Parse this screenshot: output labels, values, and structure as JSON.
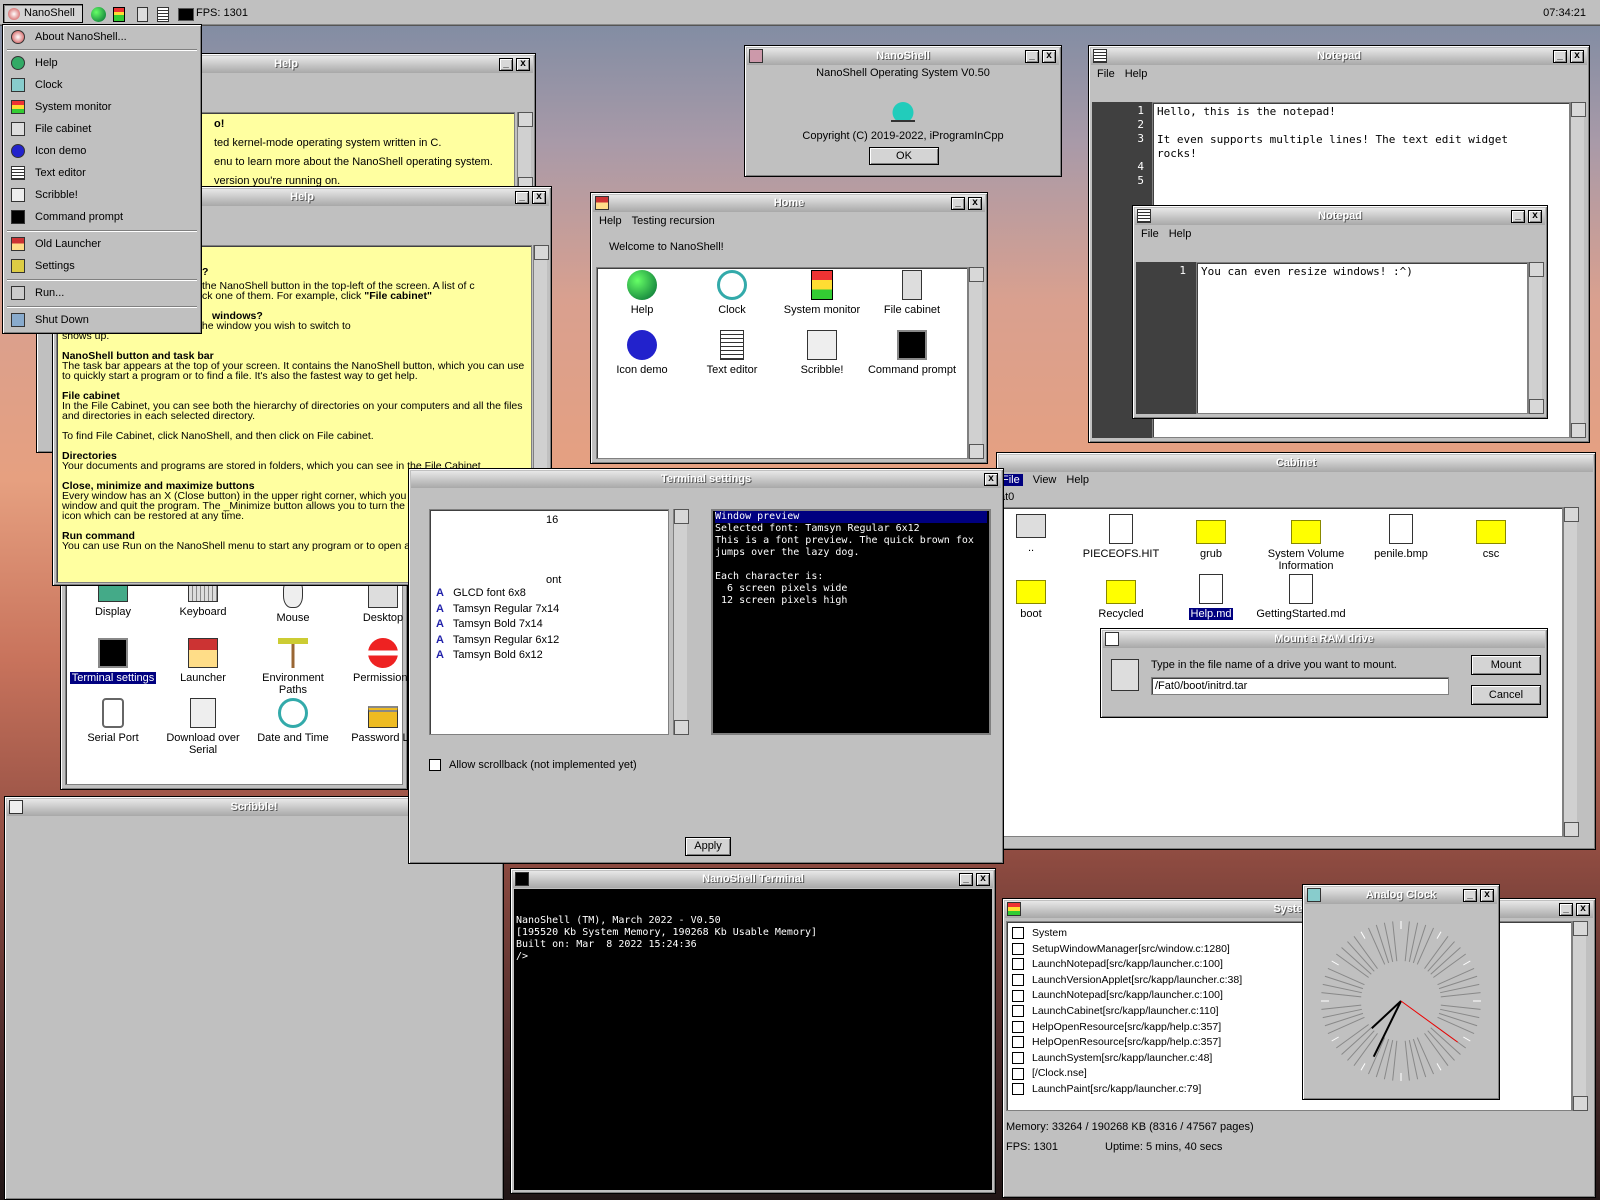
{
  "taskbar": {
    "start": "NanoShell",
    "fps": "FPS: 1301",
    "clock": "07:34:21"
  },
  "start_menu": [
    "About NanoShell...",
    "Help",
    "Clock",
    "System monitor",
    "File cabinet",
    "Icon demo",
    "Text editor",
    "Scribble!",
    "Command prompt",
    "Old Launcher",
    "Settings",
    "Run...",
    "Shut Down"
  ],
  "help1": {
    "title": "Help",
    "lines": [
      "o!",
      "ted kernel-mode operating system written in C.",
      "enu to learn more about the NanoShell operating system.",
      "version you're running on."
    ]
  },
  "help2": {
    "title": "Help",
    "q1": "?",
    "p1a": "the NanoShell button in the top-left of the screen.  A list of c",
    "p1b": "ck one of them.  For example, click ",
    "p1c": "\"File cabinet\"",
    "q2": "windows?",
    "p2a": "hold ALT and press TAB until the window you wish to switch to",
    "p2b": "shows up.",
    "h1": "NanoShell button and task bar",
    "t1": "The task bar appears at the top of your screen.  It contains the NanoShell button, which you can use to quickly start a program or to find a file.  It's also the fastest way to get help.",
    "h2": "File cabinet",
    "t2": "In the File Cabinet, you can see both the hierarchy of directories on your computers and all the files and directories in each selected directory.",
    "t3": "To find File Cabinet, click NanoShell, and then click on File cabinet.",
    "h3": "Directories",
    "t4": "Your documents and programs are stored in folders, which you can see in the File Cabinet",
    "h4": "Close, minimize and maximize buttons",
    "t5": "Every window has an X (Close button) in the upper right corner, which you can click to close the window and quit the program. The _Minimize button allows you to turn the window in to a smaller icon which can be restored at any time.",
    "h5": "Run command",
    "t6": "You can use Run on the NanoShell menu to start any program or to open any directory o"
  },
  "about": {
    "title": "NanoShell",
    "version": "NanoShell Operating System V0.50",
    "copyright": "Copyright (C) 2019-2022, iProgramInCpp",
    "ok": "OK"
  },
  "notepad1": {
    "title": "Notepad",
    "menu": [
      "File",
      "Help"
    ],
    "lines": [
      "1",
      "2",
      "3",
      "",
      "4",
      "5"
    ],
    "text1": "Hello, this is the notepad!",
    "text2": "It even supports multiple lines! The text edit widget",
    "text3": "rocks!"
  },
  "notepad2": {
    "title": "Notepad",
    "menu": [
      "File",
      "Help"
    ],
    "line": "1",
    "text": "You can even resize windows! :^)"
  },
  "home": {
    "title": "Home",
    "menu": [
      "Help",
      "Testing recursion"
    ],
    "welcome": "Welcome to NanoShell!",
    "icons": [
      "Help",
      "Clock",
      "System monitor",
      "File cabinet",
      "Icon demo",
      "Text editor",
      "Scribble!",
      "Command prompt"
    ]
  },
  "control": {
    "icons": [
      "Display",
      "Keyboard",
      "Mouse",
      "Desktop",
      "Terminal settings",
      "Launcher",
      "Environment Paths",
      "Permissions",
      "Serial Port",
      "Download over Serial",
      "Date and Time",
      "Password Lo"
    ]
  },
  "terminal_settings": {
    "title": "Terminal settings",
    "partial": [
      "16",
      "ont"
    ],
    "fonts": [
      "GLCD font 6x8",
      "Tamsyn Regular 7x14",
      "Tamsyn Bold 7x14",
      "Tamsyn Regular 6x12",
      "Tamsyn Bold 6x12"
    ],
    "preview_title": "Window preview",
    "preview": [
      "Selected font: Tamsyn Regular 6x12",
      "This is a font preview.  The quick brown fox",
      "jumps over the lazy dog.",
      "",
      "Each character is:",
      "  6 screen pixels wide",
      " 12 screen pixels high"
    ],
    "scrollback": "Allow scrollback (not implemented yet)",
    "apply": "Apply"
  },
  "cabinet": {
    "title": "Cabinet",
    "menu": [
      "File",
      "View",
      "Help"
    ],
    "path": "at0",
    "files": [
      "..",
      "PIECEOFS.HIT",
      "grub",
      "System Volume Information",
      "penile.bmp",
      "csc",
      "boot",
      "Recycled",
      "Help.md",
      "GettingStarted.md"
    ]
  },
  "mount": {
    "title": "Mount a RAM drive",
    "prompt": "Type in the file name of a drive you want to mount.",
    "value": "/Fat0/boot/initrd.tar",
    "mount": "Mount",
    "cancel": "Cancel"
  },
  "scribble": {
    "title": "Scribble!"
  },
  "terminal": {
    "title": "NanoShell Terminal",
    "lines": [
      "NanoShell (TM), March 2022 - V0.50",
      "[195520 Kb System Memory, 190268 Kb Usable Memory]",
      "Built on: Mar  8 2022 15:24:36",
      "/>"
    ]
  },
  "sysmon": {
    "title": "System M",
    "items": [
      "System",
      "SetupWindowManager[src/window.c:1280]",
      "LaunchNotepad[src/kapp/launcher.c:100]",
      "LaunchVersionApplet[src/kapp/launcher.c:38]",
      "LaunchNotepad[src/kapp/launcher.c:100]",
      "LaunchCabinet[src/kapp/launcher.c:110]",
      "HelpOpenResource[src/kapp/help.c:357]",
      "HelpOpenResource[src/kapp/help.c:357]",
      "LaunchSystem[src/kapp/launcher.c:48]",
      "[/Clock.nse]",
      "LaunchPaint[src/kapp/launcher.c:79]"
    ],
    "memory": "Memory: 33264 / 190268 KB (8316 / 47567 pages)",
    "fps": "FPS: 1301",
    "uptime": "Uptime: 5 mins, 40 secs"
  },
  "clock": {
    "title": "Analog Clock",
    "time": "07:34:21"
  }
}
